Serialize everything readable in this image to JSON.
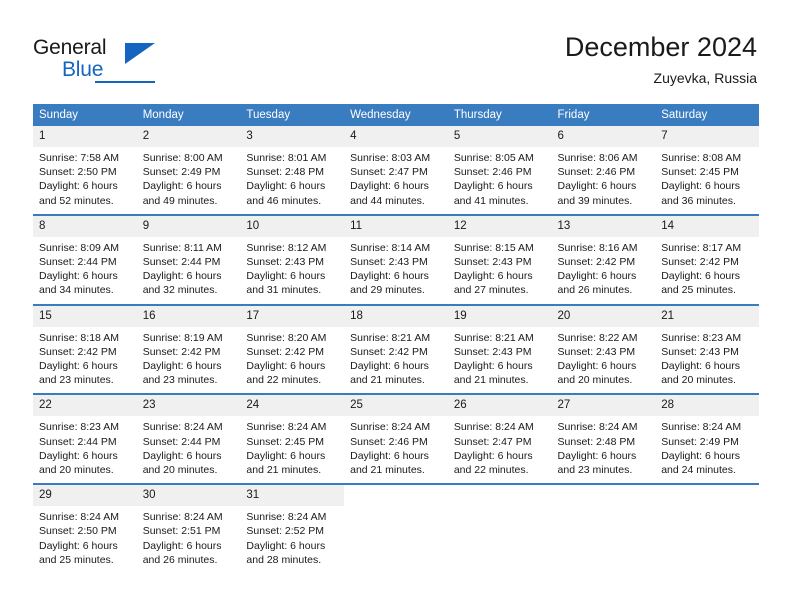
{
  "brand": {
    "name_top": "General",
    "name_bottom": "Blue"
  },
  "header": {
    "title": "December 2024",
    "subtitle": "Zuyevka, Russia"
  },
  "colors": {
    "header_blue": "#3a7cc0",
    "brand_blue": "#1565c0",
    "daynum_bg": "#f0f0f0",
    "text": "#1a1a1a"
  },
  "weekdays": [
    "Sunday",
    "Monday",
    "Tuesday",
    "Wednesday",
    "Thursday",
    "Friday",
    "Saturday"
  ],
  "weeks": [
    [
      {
        "day": "1",
        "info": "Sunrise: 7:58 AM\nSunset: 2:50 PM\nDaylight: 6 hours\nand 52 minutes."
      },
      {
        "day": "2",
        "info": "Sunrise: 8:00 AM\nSunset: 2:49 PM\nDaylight: 6 hours\nand 49 minutes."
      },
      {
        "day": "3",
        "info": "Sunrise: 8:01 AM\nSunset: 2:48 PM\nDaylight: 6 hours\nand 46 minutes."
      },
      {
        "day": "4",
        "info": "Sunrise: 8:03 AM\nSunset: 2:47 PM\nDaylight: 6 hours\nand 44 minutes."
      },
      {
        "day": "5",
        "info": "Sunrise: 8:05 AM\nSunset: 2:46 PM\nDaylight: 6 hours\nand 41 minutes."
      },
      {
        "day": "6",
        "info": "Sunrise: 8:06 AM\nSunset: 2:46 PM\nDaylight: 6 hours\nand 39 minutes."
      },
      {
        "day": "7",
        "info": "Sunrise: 8:08 AM\nSunset: 2:45 PM\nDaylight: 6 hours\nand 36 minutes."
      }
    ],
    [
      {
        "day": "8",
        "info": "Sunrise: 8:09 AM\nSunset: 2:44 PM\nDaylight: 6 hours\nand 34 minutes."
      },
      {
        "day": "9",
        "info": "Sunrise: 8:11 AM\nSunset: 2:44 PM\nDaylight: 6 hours\nand 32 minutes."
      },
      {
        "day": "10",
        "info": "Sunrise: 8:12 AM\nSunset: 2:43 PM\nDaylight: 6 hours\nand 31 minutes."
      },
      {
        "day": "11",
        "info": "Sunrise: 8:14 AM\nSunset: 2:43 PM\nDaylight: 6 hours\nand 29 minutes."
      },
      {
        "day": "12",
        "info": "Sunrise: 8:15 AM\nSunset: 2:43 PM\nDaylight: 6 hours\nand 27 minutes."
      },
      {
        "day": "13",
        "info": "Sunrise: 8:16 AM\nSunset: 2:42 PM\nDaylight: 6 hours\nand 26 minutes."
      },
      {
        "day": "14",
        "info": "Sunrise: 8:17 AM\nSunset: 2:42 PM\nDaylight: 6 hours\nand 25 minutes."
      }
    ],
    [
      {
        "day": "15",
        "info": "Sunrise: 8:18 AM\nSunset: 2:42 PM\nDaylight: 6 hours\nand 23 minutes."
      },
      {
        "day": "16",
        "info": "Sunrise: 8:19 AM\nSunset: 2:42 PM\nDaylight: 6 hours\nand 23 minutes."
      },
      {
        "day": "17",
        "info": "Sunrise: 8:20 AM\nSunset: 2:42 PM\nDaylight: 6 hours\nand 22 minutes."
      },
      {
        "day": "18",
        "info": "Sunrise: 8:21 AM\nSunset: 2:42 PM\nDaylight: 6 hours\nand 21 minutes."
      },
      {
        "day": "19",
        "info": "Sunrise: 8:21 AM\nSunset: 2:43 PM\nDaylight: 6 hours\nand 21 minutes."
      },
      {
        "day": "20",
        "info": "Sunrise: 8:22 AM\nSunset: 2:43 PM\nDaylight: 6 hours\nand 20 minutes."
      },
      {
        "day": "21",
        "info": "Sunrise: 8:23 AM\nSunset: 2:43 PM\nDaylight: 6 hours\nand 20 minutes."
      }
    ],
    [
      {
        "day": "22",
        "info": "Sunrise: 8:23 AM\nSunset: 2:44 PM\nDaylight: 6 hours\nand 20 minutes."
      },
      {
        "day": "23",
        "info": "Sunrise: 8:24 AM\nSunset: 2:44 PM\nDaylight: 6 hours\nand 20 minutes."
      },
      {
        "day": "24",
        "info": "Sunrise: 8:24 AM\nSunset: 2:45 PM\nDaylight: 6 hours\nand 21 minutes."
      },
      {
        "day": "25",
        "info": "Sunrise: 8:24 AM\nSunset: 2:46 PM\nDaylight: 6 hours\nand 21 minutes."
      },
      {
        "day": "26",
        "info": "Sunrise: 8:24 AM\nSunset: 2:47 PM\nDaylight: 6 hours\nand 22 minutes."
      },
      {
        "day": "27",
        "info": "Sunrise: 8:24 AM\nSunset: 2:48 PM\nDaylight: 6 hours\nand 23 minutes."
      },
      {
        "day": "28",
        "info": "Sunrise: 8:24 AM\nSunset: 2:49 PM\nDaylight: 6 hours\nand 24 minutes."
      }
    ],
    [
      {
        "day": "29",
        "info": "Sunrise: 8:24 AM\nSunset: 2:50 PM\nDaylight: 6 hours\nand 25 minutes."
      },
      {
        "day": "30",
        "info": "Sunrise: 8:24 AM\nSunset: 2:51 PM\nDaylight: 6 hours\nand 26 minutes."
      },
      {
        "day": "31",
        "info": "Sunrise: 8:24 AM\nSunset: 2:52 PM\nDaylight: 6 hours\nand 28 minutes."
      },
      {
        "day": "",
        "info": ""
      },
      {
        "day": "",
        "info": ""
      },
      {
        "day": "",
        "info": ""
      },
      {
        "day": "",
        "info": ""
      }
    ]
  ]
}
